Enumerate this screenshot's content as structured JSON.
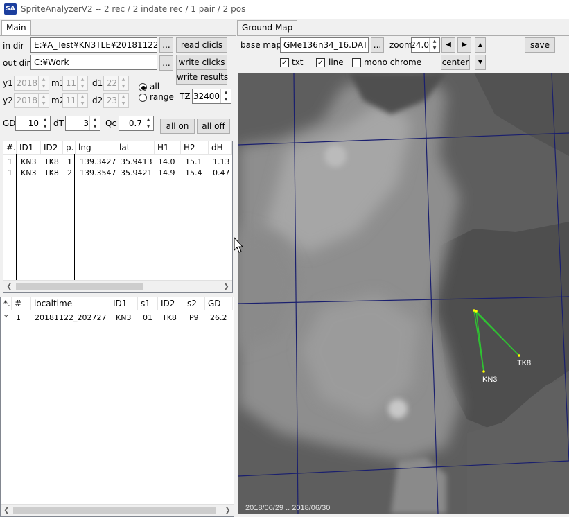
{
  "window": {
    "icon_text": "SA",
    "title": "SpriteAnalyzerV2 --  2 rec  / 2 indate rec / 1 pair / 2 pos"
  },
  "tabs": {
    "main": "Main",
    "ground_map": "Ground Map"
  },
  "main": {
    "in_dir_label": "in dir",
    "in_dir_value": "E:¥A_Test¥KN3TLE¥20181122",
    "out_dir_label": "out dir",
    "out_dir_value": "C:¥Work",
    "browse_label": "...",
    "read_clicks": "read clicls",
    "write_clicks": "write clicks",
    "write_results": "write results",
    "y1_label": "y1",
    "y1": "2018",
    "m1_label": "m1",
    "m1": "11",
    "d1_label": "d1",
    "d1": "22",
    "y2_label": "y2",
    "y2": "2018",
    "m2_label": "m2",
    "m2": "11",
    "d2_label": "d2",
    "d2": "23",
    "radio_all": "all",
    "radio_range": "range",
    "tz_label": "TZ",
    "tz": "32400",
    "gd_label": "GD",
    "gd": "10",
    "dt_label": "dT",
    "dt": "3",
    "qc_label": "Qc",
    "qc": "0.7",
    "all_on": "all on",
    "all_off": "all off"
  },
  "pos_table": {
    "headers": [
      "#.",
      "ID1",
      "ID2",
      "p.",
      "lng",
      "lat",
      "H1",
      "H2",
      "dH"
    ],
    "rows": [
      [
        "1",
        "KN3",
        "TK8",
        "1",
        "139.3427",
        "35.9413",
        "14.0",
        "15.1",
        "1.13"
      ],
      [
        "1",
        "KN3",
        "TK8",
        "2",
        "139.3547",
        "35.9421",
        "14.9",
        "15.4",
        "0.47"
      ]
    ]
  },
  "pair_table": {
    "headers": [
      "*.",
      "#",
      "localtime",
      "ID1",
      "s1",
      "ID2",
      "s2",
      "GD"
    ],
    "rows": [
      [
        "*",
        "1",
        "20181122_202727",
        "KN3",
        "01",
        "TK8",
        "P9",
        "26.2"
      ]
    ]
  },
  "map": {
    "base_map_label": "base map",
    "base_map_value": "GMe136n34_16.DAT",
    "zoom_label": "zoom",
    "zoom_value": "24.0",
    "save": "save",
    "center": "center",
    "txt_label": "txt",
    "line_label": "line",
    "mono_label": "mono chrome",
    "station_a": "KN3",
    "station_b": "TK8",
    "date_range": "2018/06/29 .. 2018/06/30"
  },
  "colors": {
    "grid": "#1a1f6e",
    "pair_line": "#2fc232",
    "marker": "#ffff00"
  }
}
